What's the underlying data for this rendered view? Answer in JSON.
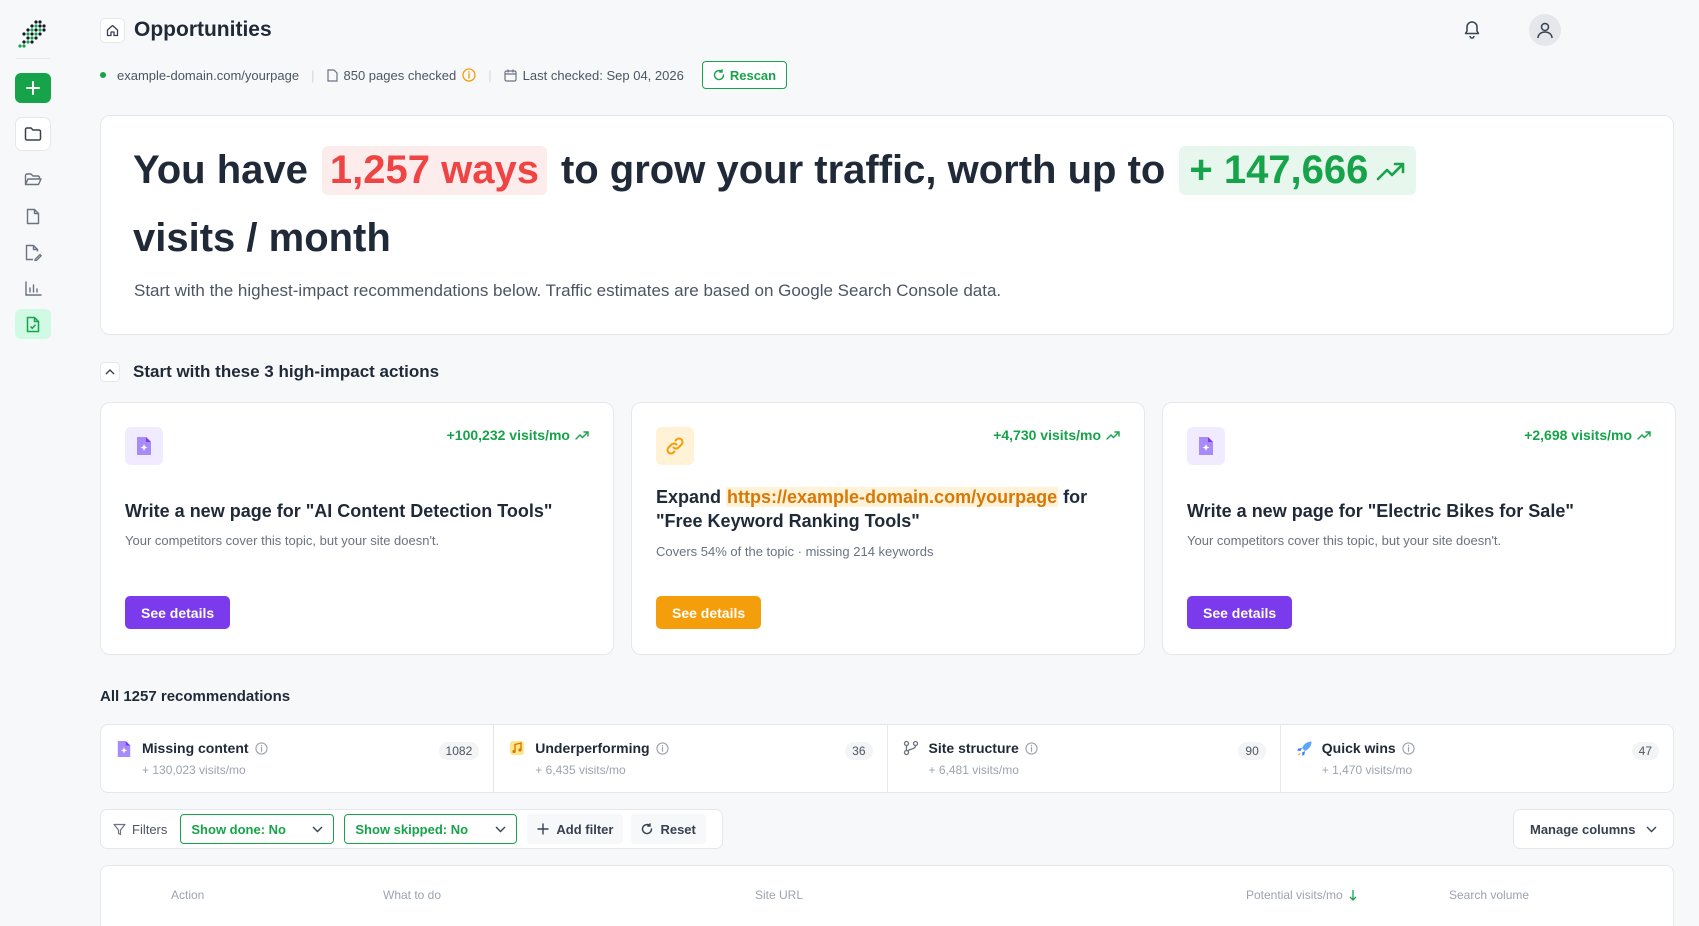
{
  "header": {
    "title": "Opportunities"
  },
  "meta": {
    "domain": "example-domain.com/yourpage",
    "pages_checked": "850 pages checked",
    "last_checked": "Last checked: Sep 04, 2026",
    "rescan_label": "Rescan"
  },
  "hero": {
    "prefix": "You have",
    "ways": "1,257 ways",
    "middle": "to grow your traffic, worth up to",
    "visits": "+ 147,666",
    "suffix": "visits / month",
    "subtitle": "Start with the highest-impact recommendations below. Traffic estimates are based on Google Search Console data."
  },
  "actions": {
    "heading": "Start with these 3 high-impact actions",
    "cards": [
      {
        "gain": "+100,232 visits/mo",
        "title": "Write a new page for \"AI Content Detection Tools\"",
        "desc": "Your competitors cover this topic, but your site doesn't.",
        "button": "See details"
      },
      {
        "gain": "+4,730 visits/mo",
        "title_prefix": "Expand",
        "title_url": "https://example-domain.com/yourpage",
        "title_suffix": "for \"Free Keyword Ranking Tools\"",
        "desc": "Covers 54% of the topic · missing 214 keywords",
        "button": "See details"
      },
      {
        "gain": "+2,698 visits/mo",
        "title": "Write a new page for \"Electric Bikes for Sale\"",
        "desc": "Your competitors cover this topic, but your site doesn't.",
        "button": "See details"
      }
    ]
  },
  "recommendations": {
    "heading": "All 1257 recommendations",
    "categories": [
      {
        "name": "Missing content",
        "visits": "+ 130,023 visits/mo",
        "count": "1082"
      },
      {
        "name": "Underperforming",
        "visits": "+ 6,435 visits/mo",
        "count": "36"
      },
      {
        "name": "Site structure",
        "visits": "+ 6,481 visits/mo",
        "count": "90"
      },
      {
        "name": "Quick wins",
        "visits": "+ 1,470 visits/mo",
        "count": "47"
      }
    ]
  },
  "filters": {
    "label": "Filters",
    "show_done": "Show done: No",
    "show_skipped": "Show skipped: No",
    "add_filter": "Add filter",
    "reset": "Reset",
    "manage_columns": "Manage columns"
  },
  "table": {
    "columns": [
      "Action",
      "What to do",
      "Site URL",
      "Potential visits/mo",
      "Search volume"
    ]
  },
  "colors": {
    "brand_green": "#16a34a",
    "accent_purple": "#7c3aed",
    "accent_orange": "#f59e0b",
    "highlight_red": "#ef4444"
  }
}
